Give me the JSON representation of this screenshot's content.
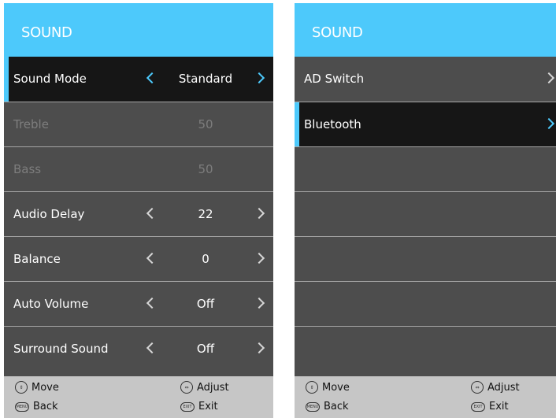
{
  "left_panel": {
    "title": "SOUND",
    "rows": [
      {
        "label": "Sound Mode",
        "value": "Standard"
      },
      {
        "label": "Treble",
        "value": "50"
      },
      {
        "label": "Bass",
        "value": "50"
      },
      {
        "label": "Audio Delay",
        "value": "22"
      },
      {
        "label": "Balance",
        "value": "0"
      },
      {
        "label": "Auto Volume",
        "value": "Off"
      },
      {
        "label": "Surround Sound",
        "value": "Off"
      }
    ],
    "footer": {
      "move": "Move",
      "adjust": "Adjust",
      "back": "Back",
      "exit": "Exit",
      "menu_icon_text": "MENU",
      "exit_icon_text": "EXIT"
    }
  },
  "right_panel": {
    "title": "SOUND",
    "rows": [
      {
        "label": "AD Switch"
      },
      {
        "label": "Bluetooth"
      }
    ],
    "footer": {
      "move": "Move",
      "adjust": "Adjust",
      "back": "Back",
      "exit": "Exit",
      "menu_icon_text": "MENU",
      "exit_icon_text": "EXIT"
    }
  },
  "colors": {
    "accent": "#4dc9fb",
    "panel_bg": "#4d4d4d",
    "selected_bg": "#161616",
    "footer_bg": "#c6c6c6",
    "disabled_text": "#7d7d7d"
  }
}
